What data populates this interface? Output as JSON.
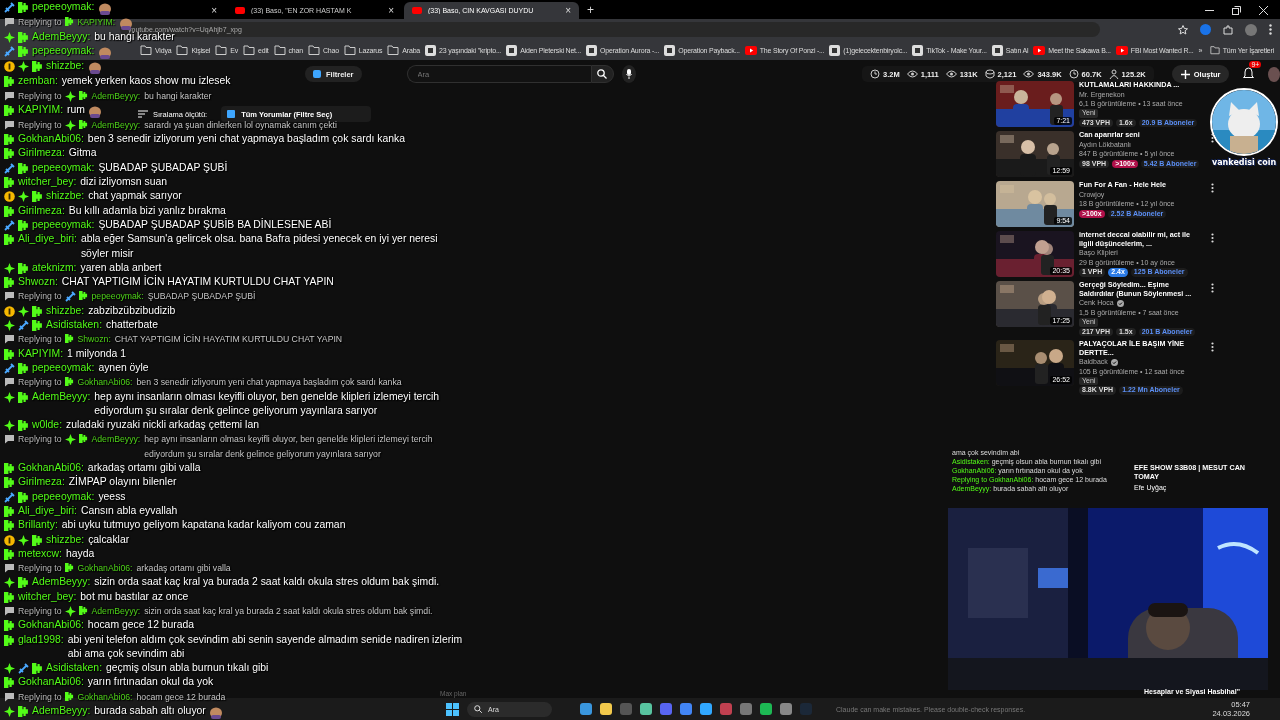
{
  "browser": {
    "tabs": [
      {
        "close": "×",
        "selected": false
      },
      {
        "title": "(33) Baso, \"EN ZOR HASTAM K",
        "close": "×",
        "selected": false
      },
      {
        "title": "(33) Baso, CİN KAVGASI DUYDU",
        "close": "×",
        "selected": true
      }
    ],
    "new_tab": "+",
    "url": "youtube.com/watch?v=UqAhjb7_xpg",
    "bookmarks": [
      {
        "kind": "folder",
        "label": "Vidya"
      },
      {
        "kind": "folder",
        "label": "Kişisel"
      },
      {
        "kind": "folder",
        "label": "Ev"
      },
      {
        "kind": "folder",
        "label": "edit"
      },
      {
        "kind": "folder",
        "label": "chan"
      },
      {
        "kind": "folder",
        "label": "Chao"
      },
      {
        "kind": "folder",
        "label": "Lazarus"
      },
      {
        "kind": "folder",
        "label": "Araba"
      },
      {
        "kind": "site",
        "label": "23 yaşındaki \"kripto..."
      },
      {
        "kind": "site",
        "label": "Aiden Pleterski Net..."
      },
      {
        "kind": "site",
        "label": "Operation Aurora -..."
      },
      {
        "kind": "site",
        "label": "Operation Payback..."
      },
      {
        "kind": "video",
        "label": "The Story Of Ponzi -..."
      },
      {
        "kind": "site",
        "label": "(1)gelecektenbiryolc..."
      },
      {
        "kind": "site",
        "label": "TikTok - Make Your..."
      },
      {
        "kind": "site",
        "label": "Satın Al"
      },
      {
        "kind": "video",
        "label": "Meet the Sakawa B..."
      },
      {
        "kind": "video",
        "label": "FBI Most Wanted R..."
      }
    ],
    "more": "»",
    "all_bookmarks": "Tüm Yer İşaretleri"
  },
  "header": {
    "filters": "Filtreler",
    "search": {
      "placeholder": "Ara"
    },
    "stats": [
      "3.2M",
      "1,111",
      "131K",
      "2,121",
      "343.9K",
      "60.7K",
      "125.2K"
    ],
    "create": "Oluştur",
    "notifications": "9+"
  },
  "comments": {
    "sort_label": "Sıralama ölçütü:",
    "filter": "Tüm Yorumlar (Filtre Seç)"
  },
  "chat": [
    {
      "kind": "message",
      "badges": [
        {
          "kind": "sword"
        }
      ],
      "user": "pepeeoymak:",
      "emote": true
    },
    {
      "kind": "reply",
      "prefix": "Replying to",
      "user": "KAPIYIM:",
      "emote": true
    },
    {
      "kind": "message",
      "badges": [
        {
          "kind": "sparkle"
        }
      ],
      "user": "AdemBeyyy:",
      "text": "bu hangi karakter",
      "emote": false
    },
    {
      "kind": "message",
      "badges": [
        {
          "kind": "sword"
        }
      ],
      "user": "pepeeoymak:",
      "emote": true
    },
    {
      "kind": "message",
      "badges": [
        {
          "kind": "tier"
        },
        {
          "kind": "sparkle"
        }
      ],
      "user": "shizzbe:",
      "emote": true
    },
    {
      "kind": "message",
      "user": "zemban:",
      "text": "yemek yerken kaos show mu izlesek",
      "emote": false
    },
    {
      "kind": "reply",
      "prefix": "Replying to",
      "badges": [
        {
          "kind": "sparkle"
        }
      ],
      "user": "AdemBeyyy:",
      "text": "bu hangi karakter",
      "emote": false
    },
    {
      "kind": "message",
      "user": "KAPIYIM:",
      "text": "rum",
      "emote": true
    },
    {
      "kind": "reply",
      "prefix": "Replying to",
      "badges": [
        {
          "kind": "sparkle"
        }
      ],
      "user": "AdemBeyyy:",
      "text": "sarardı ya şuan dinlerken lol oynamak canım çekti",
      "emote": false
    },
    {
      "kind": "message",
      "user": "GokhanAbi06:",
      "text": "ben 3 senedir izliyorum yeni chat yapmaya başladım çok sardı kanka",
      "emote": false
    },
    {
      "kind": "message",
      "user": "Girilmeza:",
      "text": "Gitma",
      "emote": false
    },
    {
      "kind": "message",
      "badges": [
        {
          "kind": "sword"
        }
      ],
      "user": "pepeeoymak:",
      "text": "ŞUBADAP ŞUBADAP ŞUBİ",
      "emote": false
    },
    {
      "kind": "message",
      "user": "witcher_bey:",
      "text": "dizi izliyomsn suan",
      "emote": false
    },
    {
      "kind": "message",
      "badges": [
        {
          "kind": "tier"
        },
        {
          "kind": "sparkle"
        }
      ],
      "user": "shizzbe:",
      "text": "chat yapmak sarıyor",
      "emote": false
    },
    {
      "kind": "message",
      "user": "Girilmeza:",
      "text": "Bu kıllı adamla bizi yanlız bırakma",
      "emote": false
    },
    {
      "kind": "message",
      "badges": [
        {
          "kind": "sword"
        }
      ],
      "user": "pepeeoymak:",
      "text": "ŞUBADAP ŞUBADAP ŞUBİB BA DİNLESENE ABİ",
      "emote": false
    },
    {
      "kind": "message",
      "user": "Ali_diye_biri:",
      "text": "abla eğer Samsun'a gelircek olsa. bana Bafra pidesi yenecek en iyi yer neresi söyler misir",
      "emote": false
    },
    {
      "kind": "message",
      "badges": [
        {
          "kind": "sparkle"
        }
      ],
      "user": "ateknizm:",
      "text": "yaren abla anbert",
      "emote": false
    },
    {
      "kind": "message",
      "user": "Shwozn:",
      "text": "CHAT YAPTIGIM İCİN HAYATIM KURTULDU CHAT YAPIN",
      "emote": false
    },
    {
      "kind": "reply",
      "prefix": "Replying to",
      "badges": [
        {
          "kind": "sword"
        }
      ],
      "user": "pepeeoymak:",
      "text": "ŞUBADAP ŞUBADAP ŞUBİ",
      "emote": false
    },
    {
      "kind": "message",
      "badges": [
        {
          "kind": "tier"
        },
        {
          "kind": "sparkle"
        }
      ],
      "user": "shizzbe:",
      "text": "zabzibzübzibudizib",
      "emote": false
    },
    {
      "kind": "message",
      "badges": [
        {
          "kind": "sparkle"
        },
        {
          "kind": "sword"
        }
      ],
      "user": "Asidistaken:",
      "text": "chatterbate",
      "emote": false
    },
    {
      "kind": "reply",
      "prefix": "Replying to",
      "user": "Shwozn:",
      "text": "CHAT YAPTIGIM İCİN HAYATIM KURTULDU CHAT YAPIN",
      "emote": false
    },
    {
      "kind": "message",
      "user": "KAPIYIM:",
      "text": "1 milyonda 1",
      "emote": false
    },
    {
      "kind": "message",
      "badges": [
        {
          "kind": "sword"
        }
      ],
      "user": "pepeeoymak:",
      "text": "aynen öyle",
      "emote": false
    },
    {
      "kind": "reply",
      "prefix": "Replying to",
      "user": "GokhanAbi06:",
      "text": "ben 3 senedir izliyorum yeni chat yapmaya başladım çok sardı kanka",
      "emote": false
    },
    {
      "kind": "message",
      "badges": [
        {
          "kind": "sparkle"
        }
      ],
      "user": "AdemBeyyy:",
      "text": "hep aynı insanların olması keyifli oluyor, ben genelde klipleri izlemeyi tercih ediyordum şu sıralar denk gelince geliyorum yayınlara sarıyor",
      "emote": false
    },
    {
      "kind": "message",
      "badges": [
        {
          "kind": "sparkle"
        }
      ],
      "user": "w0lde:",
      "text": "zuladaki ryuzaki nickli arkadaş çettemi lan",
      "emote": false
    },
    {
      "kind": "reply",
      "prefix": "Replying to",
      "badges": [
        {
          "kind": "sparkle"
        }
      ],
      "user": "AdemBeyyy:",
      "text": "hep aynı insanların olması keyifli oluyor, ben genelde klipleri izlemeyi tercih ediyordum şu sıralar denk gelince geliyorum yayınlara sarıyor",
      "emote": false
    },
    {
      "kind": "message",
      "user": "GokhanAbi06:",
      "text": "arkadaş ortamı gibi valla",
      "emote": false
    },
    {
      "kind": "message",
      "user": "Girilmeza:",
      "text": "ZİMPAP olayını bilenler",
      "emote": false
    },
    {
      "kind": "message",
      "badges": [
        {
          "kind": "sword"
        }
      ],
      "user": "pepeeoymak:",
      "text": "yeess",
      "emote": false
    },
    {
      "kind": "message",
      "user": "Ali_diye_biri:",
      "text": "Cansın abla eyvallah",
      "emote": false
    },
    {
      "kind": "message",
      "user": "Brillanty:",
      "text": "abi uyku tutmuyo geliyom kapatana kadar kaliyom cou zaman",
      "emote": false
    },
    {
      "kind": "message",
      "badges": [
        {
          "kind": "tier"
        },
        {
          "kind": "sparkle"
        }
      ],
      "user": "shizzbe:",
      "text": "çalcaklar",
      "emote": false
    },
    {
      "kind": "message",
      "user": "metexcw:",
      "text": "hayda",
      "emote": false
    },
    {
      "kind": "reply",
      "prefix": "Replying to",
      "user": "GokhanAbi06:",
      "text": "arkadaş ortamı gibi valla",
      "emote": false
    },
    {
      "kind": "message",
      "badges": [
        {
          "kind": "sparkle"
        }
      ],
      "user": "AdemBeyyy:",
      "text": "sizin orda saat kaç kral ya burada 2 saat kaldı okula stres oldum bak şimdi.",
      "emote": false
    },
    {
      "kind": "message",
      "user": "witcher_bey:",
      "text": "bot mu bastılar az once",
      "emote": false
    },
    {
      "kind": "reply",
      "prefix": "Replying to",
      "badges": [
        {
          "kind": "sparkle"
        }
      ],
      "user": "AdemBeyyy:",
      "text": "sizin orda saat kaç kral ya burada 2 saat kaldı okula stres oldum bak şimdi.",
      "emote": false
    },
    {
      "kind": "message",
      "user": "GokhanAbi06:",
      "text": "hocam gece 12 burada",
      "emote": false
    },
    {
      "kind": "message",
      "user": "glad1998:",
      "text": "abi yeni telefon aldım çok sevindim abi senin sayende almadım senide nadiren izlerim abi ama çok sevindim abi",
      "emote": false
    },
    {
      "kind": "message",
      "badges": [
        {
          "kind": "sparkle"
        },
        {
          "kind": "sword"
        }
      ],
      "user": "Asidistaken:",
      "text": "geçmiş olsun abla burnun tıkalı gibi",
      "emote": false
    },
    {
      "kind": "message",
      "user": "GokhanAbi06:",
      "text": "yarın fırtınadan okul da yok",
      "emote": false
    },
    {
      "kind": "reply",
      "prefix": "Replying to",
      "user": "GokhanAbi06:",
      "text": "hocam gece 12 burada",
      "emote": false
    },
    {
      "kind": "message",
      "badges": [
        {
          "kind": "sparkle"
        }
      ],
      "user": "AdemBeyyy:",
      "text": "burada sabah altı oluyor",
      "emote": true
    }
  ],
  "recommendations": [
    {
      "title": "KUTLAMALARI HAKKINDA ...",
      "channel": "Mr. Ergenekon",
      "verified": false,
      "menu": false,
      "meta": "6,1 B görüntüleme • 13 saat önce",
      "badge": "Yeni",
      "stats": [
        {
          "kind": "plain",
          "text": "473 VPH"
        },
        {
          "kind": "plain",
          "text": "1.6x"
        },
        {
          "kind": "subs",
          "text": "20.9 B Aboneler"
        }
      ],
      "duration": "7:21"
    },
    {
      "title": "Can aparırlar seni",
      "channel": "Aydın Lökbatanlı",
      "verified": false,
      "menu": true,
      "meta": "847 B görüntüleme • 5 yıl önce",
      "stats": [
        {
          "kind": "plain",
          "text": "98 VPH"
        },
        {
          "kind": "hot",
          "text": ">100x"
        },
        {
          "kind": "subs",
          "text": "5.42 B Aboneler"
        }
      ],
      "duration": "12:59"
    },
    {
      "title": "Fun For A Fan - Hele Hele",
      "channel": "Crowjoy",
      "verified": false,
      "menu": true,
      "meta": "18 B görüntüleme • 12 yıl önce",
      "stats": [
        {
          "kind": "hot",
          "text": ">100x"
        },
        {
          "kind": "subs",
          "text": "2.52 B Aboneler"
        }
      ],
      "duration": "9:54"
    },
    {
      "title": "internet deccal olabilir mi, act ile ilgili düşüncelerim, ...",
      "channel": "Başo Klipleri",
      "verified": false,
      "menu": true,
      "meta": "29 B görüntüleme • 10 ay önce",
      "stats": [
        {
          "kind": "plain",
          "text": "1 VPH"
        },
        {
          "kind": "up",
          "text": "2.4x"
        },
        {
          "kind": "subs",
          "text": "125 B Aboneler"
        }
      ],
      "duration": "20:35"
    },
    {
      "title": "Gerçeği Söyledim... Eşime Saldırdılar (Bunun Söylenmesi ...",
      "channel": "Cenk Hoca",
      "verified": true,
      "menu": true,
      "meta": "1,5 B görüntüleme • 7 saat önce",
      "badge": "Yeni",
      "stats": [
        {
          "kind": "plain",
          "text": "217 VPH"
        },
        {
          "kind": "plain",
          "text": "1.5x"
        },
        {
          "kind": "subs",
          "text": "201 B Aboneler"
        }
      ],
      "duration": "17:25"
    },
    {
      "title": "PALYAÇOLAR İLE BAŞIM YİNE DERTTE...",
      "channel": "Baldback",
      "verified": true,
      "menu": true,
      "meta": "105 B görüntüleme • 12 saat önce",
      "badge": "Yeni",
      "stats": [
        {
          "kind": "plain",
          "text": "8.8K VPH"
        },
        {
          "kind": "subs",
          "text": "1.22 Mn Aboneler"
        }
      ],
      "duration": "26:52"
    }
  ],
  "avatar": {
    "caption": "vankedisi coin"
  },
  "mini_chat": [
    {
      "text": "ama çok sevindim abi"
    },
    {
      "user": "Asidistaken:",
      "text": "geçmiş olsun abla burnun tıkalı gibi"
    },
    {
      "user": "GokhanAbi06:",
      "text": "yarın fırtınadan okul da yok"
    },
    {
      "user": "Replying to GokhanAbi06:",
      "text": "hocam gece 12 burada"
    },
    {
      "user": "AdemBeyyy:",
      "text": "burada sabah altı oluyor"
    }
  ],
  "next_video": {
    "title": "EFE SHOW S3B08 | MESUT CAN TOMAY",
    "channel": "Efe Uyğaç"
  },
  "bottom_video": {
    "title": "Hesaplar ve Siyasi Hasbihal\""
  },
  "taskbar": {
    "search": "Ara",
    "plan": "Max plan",
    "notice": "Claude can make mistakes. Please double-check responses.",
    "time": "05:47",
    "date": "24.03.2026"
  }
}
